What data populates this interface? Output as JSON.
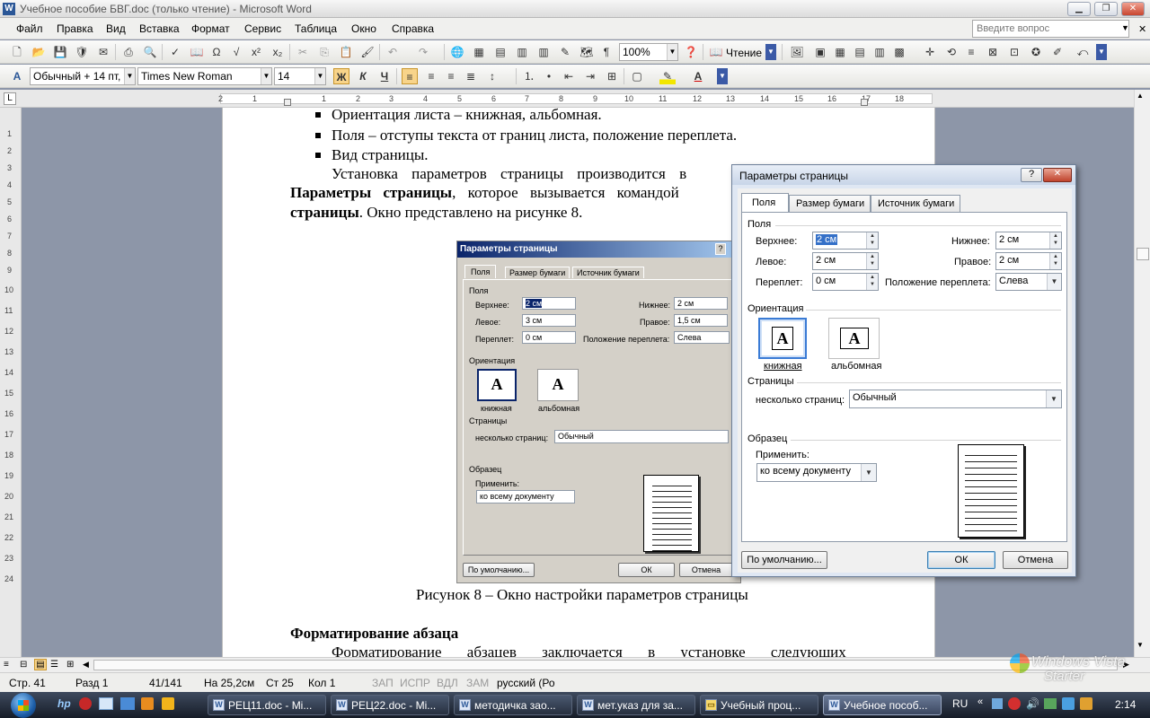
{
  "window": {
    "title": "Учебное пособие БВГ.doc (только чтение) - Microsoft Word",
    "app_icon": "W",
    "controls": [
      "minimize-icon",
      "restore-icon",
      "close-icon"
    ]
  },
  "menu": {
    "items": [
      "Файл",
      "Правка",
      "Вид",
      "Вставка",
      "Формат",
      "Сервис",
      "Таблица",
      "Окно",
      "Справка"
    ],
    "ask_placeholder": "Введите вопрос"
  },
  "toolbar_standard": {
    "zoom": "100%",
    "reading": "Чтение"
  },
  "toolbar_formatting": {
    "style": "Обычный + 14 пт,",
    "font": "Times New Roman",
    "size": "14",
    "bold": "Ж",
    "italic": "К",
    "underline": "Ч"
  },
  "ruler": {
    "numbers": [
      "2",
      "1",
      "1",
      "2",
      "3",
      "4",
      "5",
      "6",
      "7",
      "8",
      "9",
      "10",
      "11",
      "12",
      "13",
      "14",
      "15",
      "16",
      "17",
      "18"
    ]
  },
  "vruler": {
    "numbers": [
      "1",
      "2",
      "3",
      "4",
      "5",
      "6",
      "7",
      "8",
      "9",
      "10",
      "11",
      "12",
      "13",
      "14",
      "15",
      "16",
      "17",
      "18",
      "19",
      "20",
      "21",
      "22",
      "23",
      "24"
    ]
  },
  "document": {
    "bullets": [
      "Ориентация листа – книжная, альбомная.",
      "Поля – отступы текста от границ листа, положение переплета.",
      "Вид страницы."
    ],
    "para1": "Установка параметров страницы производится в",
    "para2_bold": "Параметры страницы",
    "para2_rest": ", которое вызывается командой",
    "para3_bold": "страницы",
    "para3_rest": ". Окно представлено на рисунке 8.",
    "caption": "Рисунок 8 – Окно настройки параметров страницы",
    "heading": "Форматирование абзаца",
    "para_last": "Форматирование абзацев заключается в установке следующих"
  },
  "figure_dialog": {
    "title": "Параметры страницы",
    "tabs": [
      "Поля",
      "Размер бумаги",
      "Источник бумаги"
    ],
    "group_fields": "Поля",
    "top_label": "Верхнее:",
    "top_value": "2 см",
    "bottom_label": "Нижнее:",
    "bottom_value": "2 см",
    "left_label": "Левое:",
    "left_value": "3 см",
    "right_label": "Правое:",
    "right_value": "1,5 см",
    "gutter_label": "Переплет:",
    "gutter_value": "0 см",
    "gutter_pos_label": "Положение переплета:",
    "gutter_pos_value": "Слева",
    "group_orientation": "Ориентация",
    "portrait": "книжная",
    "landscape": "альбомная",
    "orientation_glyph": "A",
    "group_pages": "Страницы",
    "pages_label": "несколько страниц:",
    "pages_value": "Обычный",
    "group_sample": "Образец",
    "apply_label": "Применить:",
    "apply_value": "ко всему документу",
    "default_button": "По умолчанию...",
    "ok_button": "ОК",
    "cancel_button": "Отмена"
  },
  "dialog": {
    "title": "Параметры страницы",
    "tabs": [
      "Поля",
      "Размер бумаги",
      "Источник бумаги"
    ],
    "group_fields": "Поля",
    "top_label": "Верхнее:",
    "top_value": "2 см",
    "bottom_label": "Нижнее:",
    "bottom_value": "2 см",
    "left_label": "Левое:",
    "left_value": "2 см",
    "right_label": "Правое:",
    "right_value": "2 см",
    "gutter_label": "Переплет:",
    "gutter_value": "0 см",
    "gutter_pos_label": "Положение переплета:",
    "gutter_pos_value": "Слева",
    "group_orientation": "Ориентация",
    "portrait": "книжная",
    "landscape": "альбомная",
    "orientation_glyph": "A",
    "group_pages": "Страницы",
    "pages_label": "несколько страниц:",
    "pages_value": "Обычный",
    "group_sample": "Образец",
    "apply_label": "Применить:",
    "apply_value": "ко всему документу",
    "default_button": "По умолчанию...",
    "ok_button": "ОК",
    "cancel_button": "Отмена",
    "help_glyph": "?",
    "close_glyph": "✕"
  },
  "status": {
    "page": "Стр. 41",
    "section": "Разд 1",
    "pages": "41/141",
    "at": "На 25,2см",
    "line": "Ст 25",
    "col": "Кол 1",
    "rec": "ЗАП",
    "trk": "ИСПР",
    "ext": "ВДЛ",
    "ovr": "ЗАМ",
    "lang": "русский (Ро"
  },
  "watermark": {
    "line1": "Windows Vista",
    "line2": "Starter"
  },
  "taskbar": {
    "tasks": [
      "РЕЦ11.doc - Mi...",
      "РЕЦ22.doc - Mi...",
      "методичка зао...",
      "мет.указ для за...",
      "Учебный проц...",
      "Учебное пособ..."
    ],
    "lang": "RU",
    "time": "2:14"
  }
}
